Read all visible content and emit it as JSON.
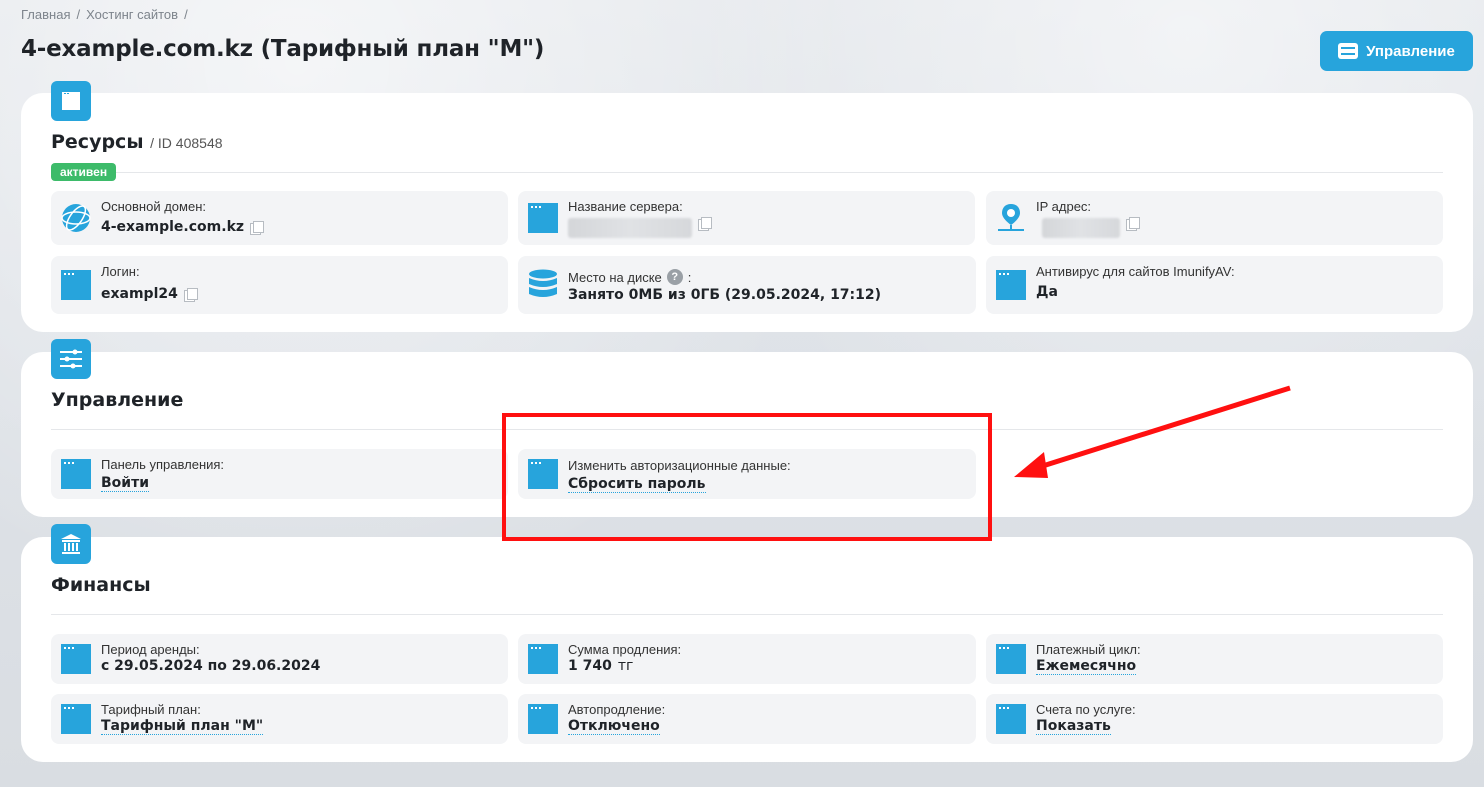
{
  "breadcrumb": [
    "Главная",
    "Хостинг сайтов"
  ],
  "page_title": "4-example.com.kz (Тарифный план \"M\")",
  "header_button": "Управление",
  "resources": {
    "title": "Ресурсы",
    "id_label": "/ ID 408548",
    "status": "активен",
    "fields": {
      "domain": {
        "label": "Основной домен:",
        "value": "4-example.com.kz"
      },
      "server": {
        "label": "Название сервера:"
      },
      "ip": {
        "label": "IP адрес:"
      },
      "login": {
        "label": "Логин:",
        "value": "exampl24"
      },
      "disk": {
        "label": "Место на диске",
        "suffix": ":",
        "value": "Занято 0МБ из 0ГБ (29.05.2024, 17:12)"
      },
      "antivirus": {
        "label": "Антивирус для сайтов ImunifyAV:",
        "value": "Да"
      }
    }
  },
  "management": {
    "title": "Управление",
    "panel": {
      "label": "Панель управления:",
      "value": "Войти"
    },
    "auth": {
      "label": "Изменить авторизационные данные:",
      "value": "Сбросить пароль"
    }
  },
  "finance": {
    "title": "Финансы",
    "period": {
      "label": "Период аренды:",
      "value": "с 29.05.2024 по 29.06.2024"
    },
    "sum": {
      "label": "Сумма продления:",
      "value": "1 740",
      "currency": "тг"
    },
    "cycle": {
      "label": "Платежный цикл:",
      "value": "Ежемесячно"
    },
    "plan": {
      "label": "Тарифный план:",
      "value": "Тарифный план \"M\""
    },
    "autorenew": {
      "label": "Автопродление:",
      "value": "Отключено"
    },
    "invoices": {
      "label": "Счета по услуге:",
      "value": "Показать"
    }
  },
  "colors": {
    "accent": "#27a4dc",
    "success": "#3dbb6a",
    "highlight": "#ff1010"
  }
}
